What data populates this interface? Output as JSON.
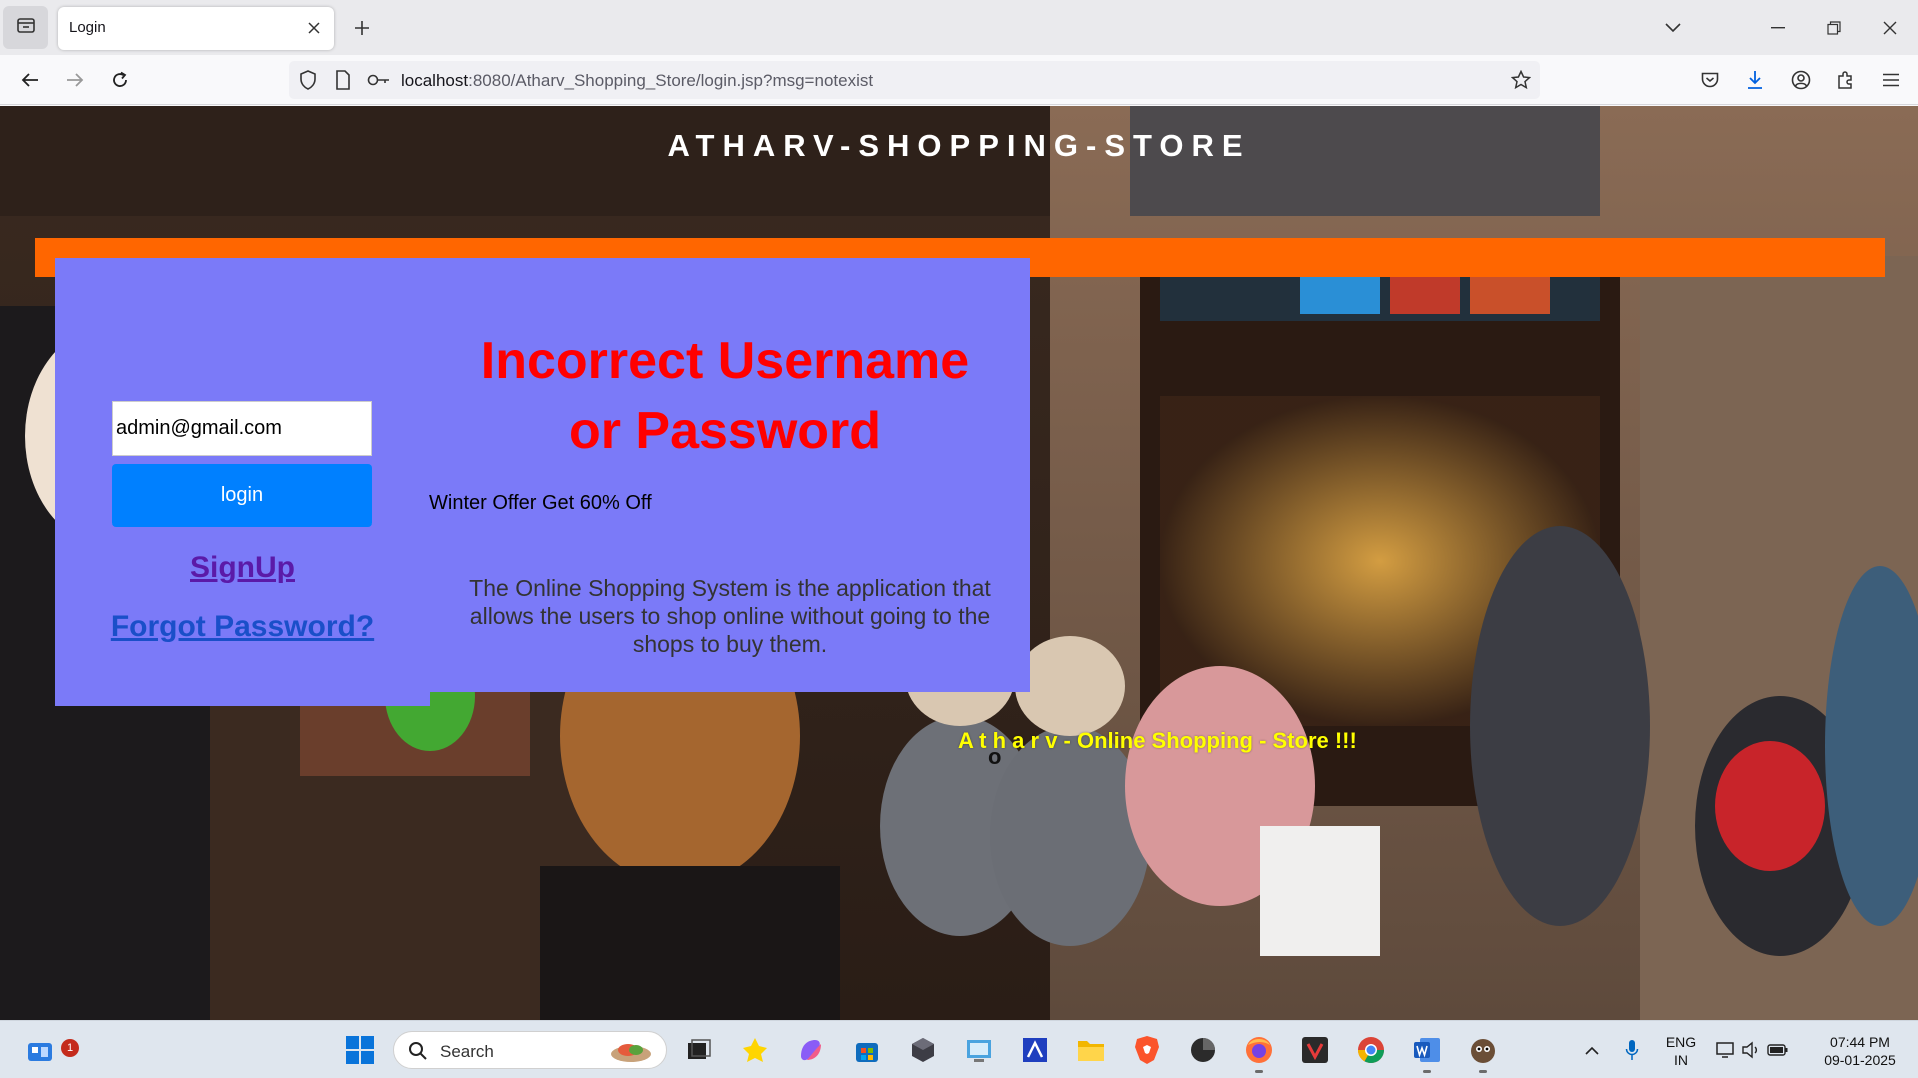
{
  "browser": {
    "tab_title": "Login",
    "url_host": "localhost",
    "url_rest": ":8080/Atharv_Shopping_Store/login.jsp?msg=notexist"
  },
  "page": {
    "site_title": "ATHARV-SHOPPING-STORE",
    "email_value": "admin@gmail.com",
    "password_value": "•••••••••",
    "login_label": "login",
    "signup_label": "SignUp",
    "forgot_label": "Forgot Password?",
    "error_line1": "Incorrect Username",
    "error_line2": "or Password",
    "offer_text": "Winter Offer Get 60% Off",
    "description": "The Online Shopping System is the application that allows the users to shop online without going to the shops to buy them.",
    "marquee_text": "A t h a r v - Online Shopping - Store !!!",
    "cursor_char": "o"
  },
  "taskbar": {
    "search_label": "Search",
    "notification_count": "1",
    "lang_line1": "ENG",
    "lang_line2": "IN",
    "time": "07:44 PM",
    "date": "09-01-2025"
  }
}
